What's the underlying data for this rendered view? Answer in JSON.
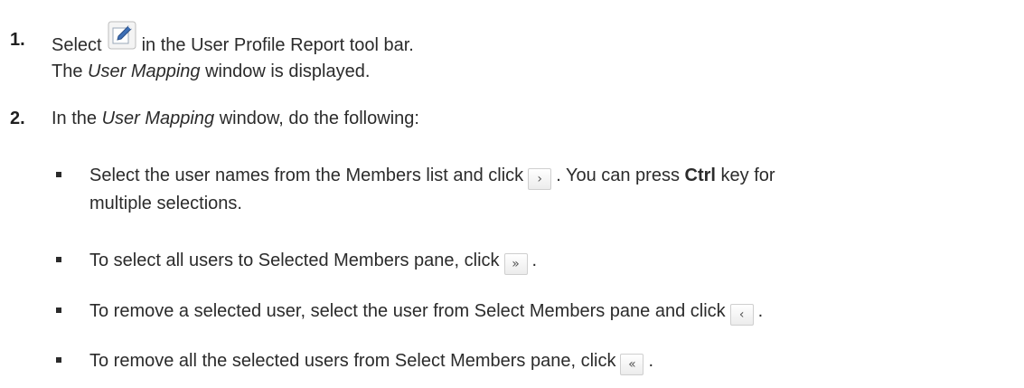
{
  "steps": [
    {
      "number": "1.",
      "line1_pre": "Select",
      "line1_post": "in the User Profile Report tool bar.",
      "line2_em": "User Mapping",
      "line2_pre": "The",
      "line2_post": "window is displayed."
    },
    {
      "number": "2.",
      "pre": "In the",
      "em": "User Mapping",
      "post": "window, do the following:"
    }
  ],
  "bullets": [
    {
      "pre": "Select the user names from the Members list and click",
      "post": ". You can press",
      "bold": "Ctrl",
      "post2": "key for",
      "line2": "multiple selections.",
      "button_glyph": "›",
      "button_icon": "move-right-icon"
    },
    {
      "pre": "To select all users to Selected Members pane, click",
      "post": ".",
      "button_glyph": "»",
      "button_icon": "move-all-right-icon"
    },
    {
      "pre": "To remove a selected user, select the user from Select Members pane and click",
      "post": ".",
      "button_glyph": "‹",
      "button_icon": "move-left-icon"
    },
    {
      "pre": "To remove all the selected users from Select Members pane, click",
      "post": ".",
      "button_glyph": "«",
      "button_icon": "move-all-left-icon"
    }
  ],
  "icons": {
    "edit": "edit-icon"
  },
  "colors": {
    "text": "#2b2b2b",
    "icon_blue": "#3d6fb6"
  }
}
